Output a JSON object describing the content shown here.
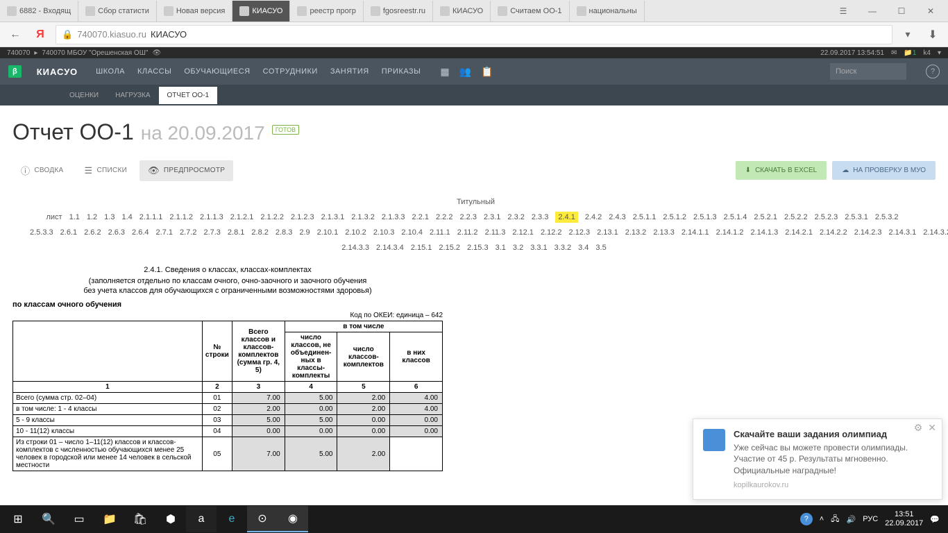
{
  "browser": {
    "tabs": [
      {
        "label": "6882 - Входящ"
      },
      {
        "label": "Сбор статисти"
      },
      {
        "label": "Новая версия"
      },
      {
        "label": "КИАСУО",
        "active": true
      },
      {
        "label": "реестр прогр"
      },
      {
        "label": "fgosreestr.ru"
      },
      {
        "label": "КИАСУО"
      },
      {
        "label": "Считаем ОО-1"
      },
      {
        "label": "национальны"
      }
    ],
    "url_prefix": "740070.kiasuo.ru",
    "url_title": "КИАСУО"
  },
  "app_bar": {
    "code": "740070",
    "school": "740070 МБОУ \"Орешенская ОШ\"",
    "datetime": "22.09.2017 13:54:51",
    "user": "k4"
  },
  "main_nav": {
    "brand": "КИАСУО",
    "items": [
      "ШКОЛА",
      "КЛАССЫ",
      "ОБУЧАЮЩИЕСЯ",
      "СОТРУДНИКИ",
      "ЗАНЯТИЯ",
      "ПРИКАЗЫ"
    ],
    "search_placeholder": "Поиск"
  },
  "sub_nav": {
    "items": [
      {
        "label": "ОЦЕНКИ"
      },
      {
        "label": "НАГРУЗКА"
      },
      {
        "label": "ОТЧЕТ ОО-1",
        "active": true
      }
    ]
  },
  "page": {
    "title": "Отчет ОО-1",
    "date": "на 20.09.2017",
    "status": "ГОТОВ"
  },
  "toolbar": {
    "summary": "СВОДКА",
    "lists": "СПИСКИ",
    "preview": "ПРЕДПРОСМОТР",
    "excel": "СКАЧАТЬ В EXCEL",
    "upload": "НА ПРОВЕРКУ В МУО"
  },
  "sections": {
    "row1": [
      "Титульный лист",
      "1.1",
      "1.2",
      "1.3",
      "1.4",
      "2.1.1.1",
      "2.1.1.2",
      "2.1.1.3",
      "2.1.2.1",
      "2.1.2.2",
      "2.1.2.3",
      "2.1.3.1",
      "2.1.3.2",
      "2.1.3.3",
      "2.2.1",
      "2.2.2",
      "2.2.3",
      "2.3.1",
      "2.3.2",
      "2.3.3",
      "2.4.1",
      "2.4.2",
      "2.4.3",
      "2.5.1.1",
      "2.5.1.2",
      "2.5.1.3",
      "2.5.1.4",
      "2.5.2.1",
      "2.5.2.2",
      "2.5.2.3",
      "2.5.3.1",
      "2.5.3.2"
    ],
    "row2": [
      "2.5.3.3",
      "2.6.1",
      "2.6.2",
      "2.6.3",
      "2.6.4",
      "2.7.1",
      "2.7.2",
      "2.7.3",
      "2.8.1",
      "2.8.2",
      "2.8.3",
      "2.9",
      "2.10.1",
      "2.10.2",
      "2.10.3",
      "2.10.4",
      "2.11.1",
      "2.11.2",
      "2.11.3",
      "2.12.1",
      "2.12.2",
      "2.12.3",
      "2.13.1",
      "2.13.2",
      "2.13.3",
      "2.14.1.1",
      "2.14.1.2",
      "2.14.1.3",
      "2.14.2.1",
      "2.14.2.2",
      "2.14.2.3",
      "2.14.3.1",
      "2.14.3.2"
    ],
    "row3": [
      "2.14.3.3",
      "2.14.3.4",
      "2.15.1",
      "2.15.2",
      "2.15.3",
      "3.1",
      "3.2",
      "3.3.1",
      "3.3.2",
      "3.4",
      "3.5"
    ],
    "active": "2.4.1"
  },
  "report": {
    "title": "2.4.1. Сведения о классах, классах-комплектах",
    "subtitle1": "(заполняется отдельно по классам очного, очно-заочного и заочного обучения",
    "subtitle2": "без учета классов для обучающихся с ограниченными возможностями здоровья)",
    "group_label": "по классам очного обучения",
    "okei": "Код по ОКЕИ: единица – 642",
    "headers": {
      "col1": "№ строки",
      "col2": "Всего классов и классов-комплектов (сумма гр. 4, 5)",
      "group": "в том числе",
      "col3": "число классов, не объединен-ных в классы-комплекты",
      "col4": "число классов-комплектов",
      "col5": "в них классов"
    },
    "colnums": [
      "1",
      "2",
      "3",
      "4",
      "5",
      "6"
    ],
    "rows": [
      {
        "label": "Всего (сумма стр. 02–04)",
        "n": "01",
        "v": [
          "7.00",
          "5.00",
          "2.00",
          "4.00"
        ]
      },
      {
        "label": "в том числе:\n1 - 4 классы",
        "n": "02",
        "v": [
          "2.00",
          "0.00",
          "2.00",
          "4.00"
        ]
      },
      {
        "label": "5 - 9 классы",
        "n": "03",
        "v": [
          "5.00",
          "5.00",
          "0.00",
          "0.00"
        ]
      },
      {
        "label": "10 - 11(12) классы",
        "n": "04",
        "v": [
          "0.00",
          "0.00",
          "0.00",
          "0.00"
        ]
      },
      {
        "label": "Из строки 01 – число 1–11(12) классов и классов-комплектов с численностью обучающихся менее 25 человек в городской или менее 14 человек в сельской местности",
        "n": "05",
        "v": [
          "7.00",
          "5.00",
          "2.00",
          ""
        ]
      }
    ]
  },
  "notification": {
    "title": "Скачайте ваши задания олимпиад",
    "text": "Уже сейчас вы можете провести олимпиады. Участие от 45 р. Результаты мгновенно. Официальные наградные!",
    "source": "kopilkaurokov.ru"
  },
  "taskbar": {
    "time": "13:51",
    "date": "22.09.2017",
    "lang": "РУС"
  }
}
